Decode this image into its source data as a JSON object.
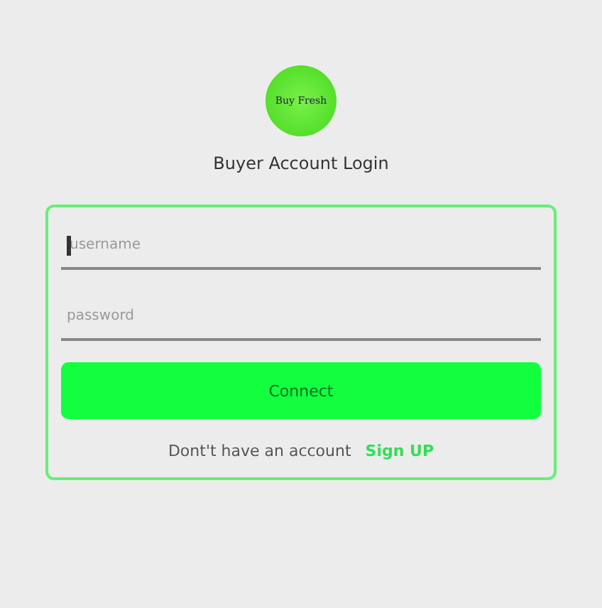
{
  "logo": {
    "text": "Buy Fresh"
  },
  "title": "Buyer Account Login",
  "fields": [
    {
      "placeholder": "username",
      "focused": true
    },
    {
      "placeholder": "password",
      "focused": false
    }
  ],
  "connect_button": "Connect",
  "footer": {
    "prompt": "Dont't have an account",
    "link": "Sign UP"
  }
}
